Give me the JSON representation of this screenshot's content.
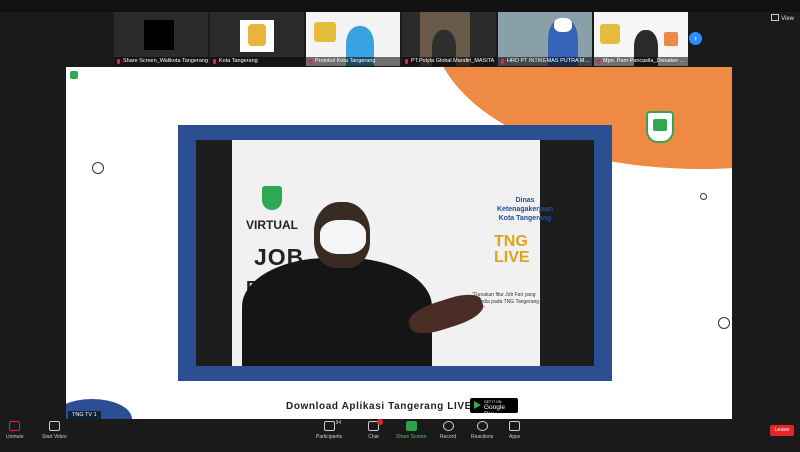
{
  "gallery": {
    "participants": [
      {
        "name": "Share Screen_Walikota Tangerang"
      },
      {
        "name": "Kota Tangerang"
      },
      {
        "name": "Protokol Kota Tangerang"
      },
      {
        "name": "PT.Polyta Global Mandiri_MASITA"
      },
      {
        "name": "HRD PT INTIKEMAS PUTRA MAK..."
      },
      {
        "name": "Mpn. Pam Pancasila_Disnaker Kota..."
      }
    ],
    "view_label": "View",
    "next_icon": "chevron-right-icon"
  },
  "share": {
    "slide": {
      "virtual": "VIRTUAL",
      "job": "JOB",
      "fair": "FAIR",
      "dinas": "Dinas Ketenagakerjaan Kota Tangerang",
      "tng_live": "TNG LIVE",
      "quote": "\"Gunakan fitur Job Fair yang tersedia pada TNG Tangerang LIVE\"",
      "download": "Download Aplikasi Tangerang LIVE",
      "gplay_top": "GET IT ON",
      "gplay_main": "Google Play"
    },
    "speaker_label": "TNG TV 1"
  },
  "toolbar": {
    "unmute": "Unmute",
    "start_video": "Start Video",
    "participants": "Participants",
    "participants_count": "94",
    "chat": "Chat",
    "share_screen": "Share Screen",
    "record": "Record",
    "reactions": "Reactions",
    "apps": "Apps",
    "leave": "Leave"
  },
  "colors": {
    "accent": "#2d8cff",
    "share_green": "#2ca24b",
    "leave_red": "#e02828",
    "slide_orange": "#ee8a44",
    "slide_blue": "#2c4f94"
  }
}
